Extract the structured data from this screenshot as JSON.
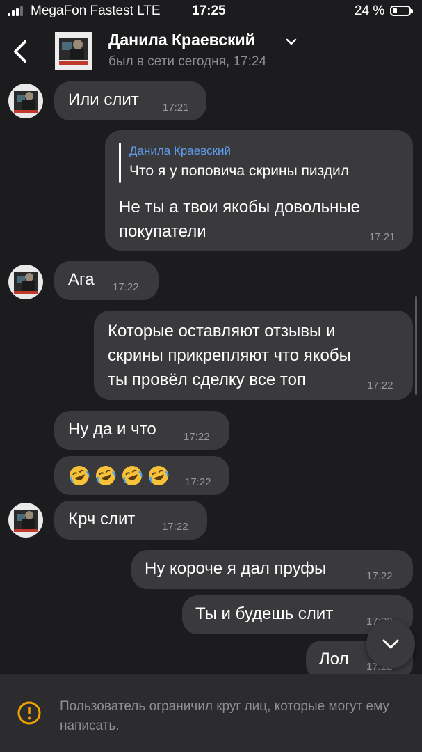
{
  "status_bar": {
    "carrier": "MegaFon Fastest  LTE",
    "time": "17:25",
    "battery": "24 %",
    "battery_level": 0.24,
    "signal_bars": 3
  },
  "header": {
    "name": "Данила Краевский",
    "status": "был в сети сегодня, 17:24",
    "back_icon": "chevron-left-icon",
    "dropdown_icon": "chevron-down-icon"
  },
  "messages": [
    {
      "direction": "incoming",
      "text": "Или слит",
      "time": "17:21"
    },
    {
      "direction": "outgoing",
      "reply": {
        "author": "Данила Краевский",
        "text": "Что я у поповича скрины пиздил"
      },
      "lines": [
        "Не ты а твои якобы довольные",
        "покупатели"
      ],
      "time": "17:21"
    },
    {
      "direction": "incoming",
      "text": "Ага",
      "time": "17:22"
    },
    {
      "direction": "outgoing",
      "lines": [
        "Которые оставляют отзывы и",
        "скрины прикрепляют что якобы",
        "ты провёл сделку все топ"
      ],
      "time": "17:22"
    },
    {
      "direction": "incoming",
      "text": "Ну да и что",
      "time": "17:22"
    },
    {
      "direction": "incoming",
      "emoji": [
        "🤣",
        "🤣",
        "🤣",
        "🤣"
      ],
      "time": "17:22"
    },
    {
      "direction": "incoming",
      "text": "Крч слит",
      "time": "17:22"
    },
    {
      "direction": "outgoing",
      "text": "Ну короче я дал пруфы",
      "time": "17:22"
    },
    {
      "direction": "outgoing",
      "text": "Ты и будешь слит",
      "time": "17:22"
    },
    {
      "direction": "outgoing",
      "text": "Лол",
      "time": "17:22"
    }
  ],
  "footer": {
    "text": "Пользователь ограничил круг лиц, которые могут ему написать.",
    "icon": "warning-circle-icon"
  },
  "colors": {
    "background": "#1c1c1e",
    "bubble": "#3a3a3c",
    "footer": "#2c2c2e",
    "reply_author": "#5f9cf0",
    "secondary_text": "#8e8e93"
  }
}
